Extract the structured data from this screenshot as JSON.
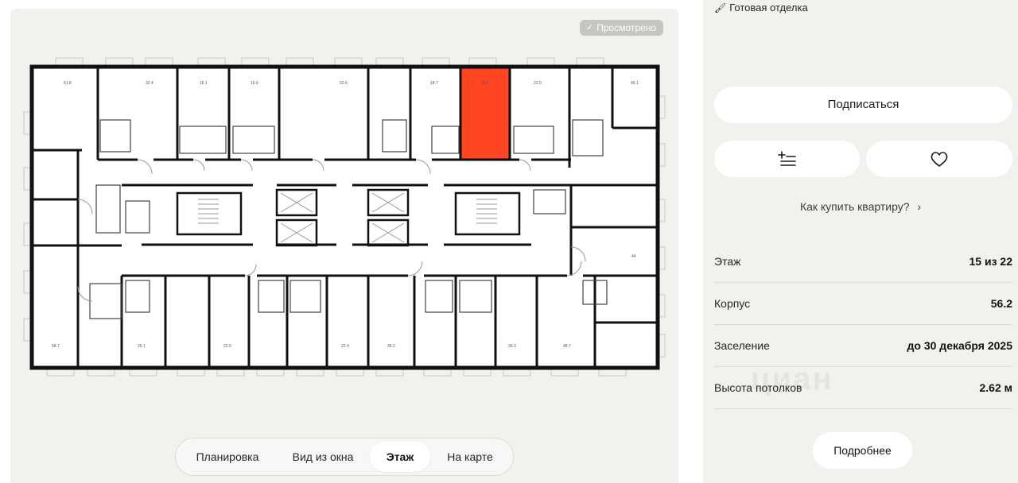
{
  "badge": {
    "viewed": "Просмотрено"
  },
  "colors": {
    "highlight": "#ff4422",
    "wall": "#111111",
    "panel_bg": "#f2f1ee"
  },
  "plan": {
    "top_area_labels": [
      "61.8",
      "32.4",
      "16.1",
      "10.6",
      "62.6",
      "18.7",
      "10.7",
      "22.0",
      "46.1"
    ],
    "bottom_area_labels": [
      "58.7",
      "26.1",
      "22.6",
      "22.4",
      "36.2",
      "30.3",
      "48.7"
    ],
    "right_area_label": "44"
  },
  "view_tabs": [
    {
      "label": "Планировка",
      "active": false
    },
    {
      "label": "Вид из окна",
      "active": false
    },
    {
      "label": "Этаж",
      "active": true
    },
    {
      "label": "На карте",
      "active": false
    }
  ],
  "sidebar": {
    "finish": "Готовая отделка",
    "subscribe": "Подписаться",
    "compare_icon": "add-to-compare-icon",
    "favorite_icon": "heart-icon",
    "how_to_buy": "Как купить квартиру?",
    "how_to_buy_arrow": "›",
    "params": [
      {
        "label": "Этаж",
        "value": "15 из 22"
      },
      {
        "label": "Корпус",
        "value": "56.2"
      },
      {
        "label": "Заселение",
        "value": "до 30 декабря 2025"
      },
      {
        "label": "Высота потолков",
        "value": "2.62 м"
      }
    ],
    "more": "Подробнее",
    "watermark": "циан"
  }
}
